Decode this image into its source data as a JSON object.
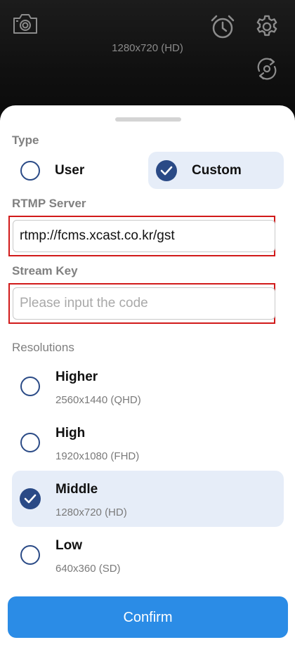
{
  "top_bar": {
    "current_resolution": "1280x720 (HD)",
    "icons": [
      "camera-icon",
      "alarm-clock-icon",
      "settings-gear-icon",
      "switch-camera-icon"
    ]
  },
  "sheet": {
    "type": {
      "label": "Type",
      "options": [
        {
          "label": "User",
          "selected": false
        },
        {
          "label": "Custom",
          "selected": true
        }
      ]
    },
    "rtmp_server": {
      "label": "RTMP Server",
      "value": "rtmp://fcms.xcast.co.kr/gst"
    },
    "stream_key": {
      "label": "Stream Key",
      "value": "",
      "placeholder": "Please input the code"
    },
    "resolutions": {
      "label": "Resolutions",
      "options": [
        {
          "title": "Higher",
          "sub": "2560x1440 (QHD)",
          "selected": false
        },
        {
          "title": "High",
          "sub": "1920x1080 (FHD)",
          "selected": false
        },
        {
          "title": "Middle",
          "sub": "1280x720 (HD)",
          "selected": true
        },
        {
          "title": "Low",
          "sub": "640x360 (SD)",
          "selected": false
        }
      ]
    },
    "confirm_label": "Confirm"
  },
  "colors": {
    "accent": "#2a4a86",
    "selected_bg": "#e6edf8",
    "confirm_bg": "#2b8ce6",
    "highlight_outline": "#d11a1a"
  }
}
